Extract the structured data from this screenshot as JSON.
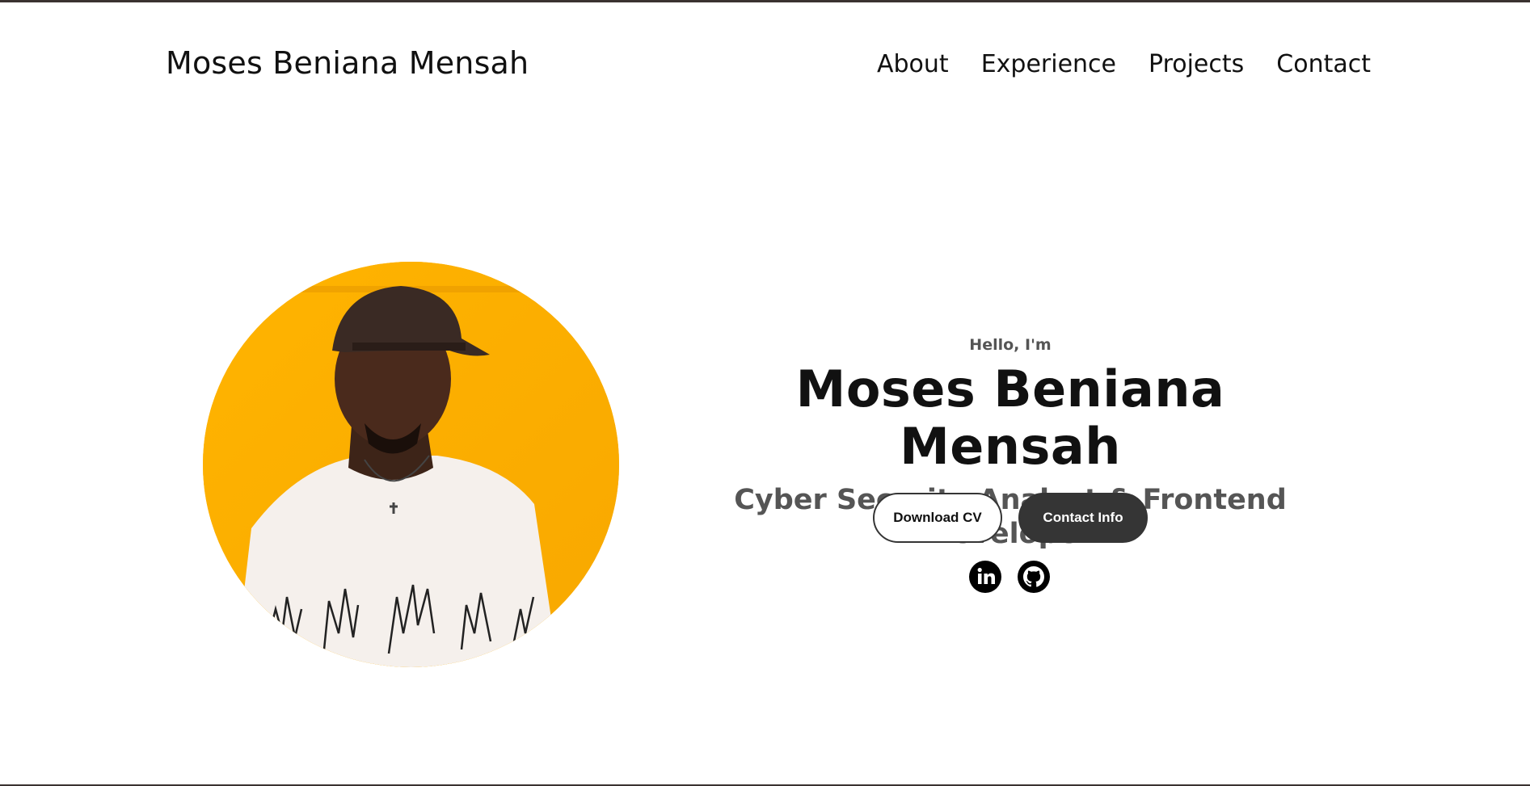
{
  "header": {
    "brand": "Moses Beniana Mensah",
    "nav": [
      "About",
      "Experience",
      "Projects",
      "Contact"
    ]
  },
  "hero": {
    "greeting": "Hello, I'm",
    "name": "Moses Beniana Mensah",
    "role": "Cyber Security Analyst & Frontend Developer",
    "buttons": {
      "download_cv": "Download CV",
      "contact_info": "Contact Info"
    },
    "socials": [
      "linkedin-icon",
      "github-icon"
    ]
  },
  "colors": {
    "accent_dark": "#353535",
    "photo_background": "#ffb000",
    "muted_text": "#555555"
  }
}
